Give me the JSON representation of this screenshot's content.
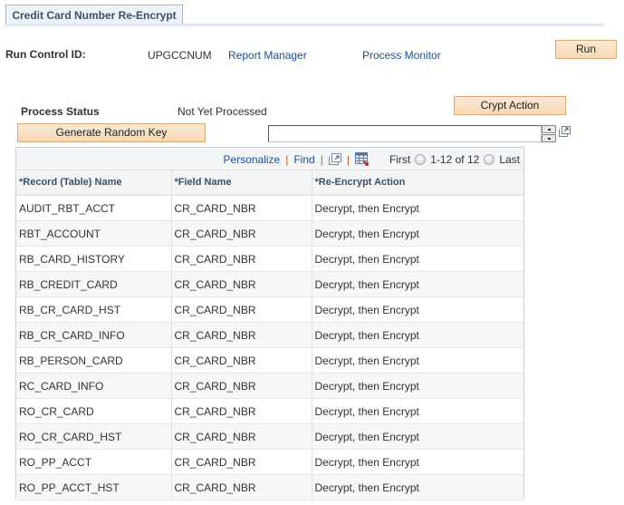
{
  "page": {
    "tab_title": "Credit Card Number Re-Encrypt"
  },
  "run_control": {
    "label": "Run Control ID:",
    "value": "UPGCCNUM",
    "report_manager_link": "Report Manager",
    "process_monitor_link": "Process Monitor",
    "run_button": "Run"
  },
  "process": {
    "status_label": "Process Status",
    "status_value": "Not Yet Processed",
    "crypt_action_button": "Crypt Action",
    "generate_key_button": "Generate Random Key",
    "key_input_value": ""
  },
  "grid": {
    "toolbar": {
      "personalize": "Personalize",
      "find": "Find",
      "first": "First",
      "range": "1-12 of 12",
      "last": "Last",
      "separator": "|"
    },
    "columns": [
      "*Record (Table) Name",
      "*Field Name",
      "*Re-Encrypt Action"
    ],
    "rows": [
      [
        "AUDIT_RBT_ACCT",
        "CR_CARD_NBR",
        "Decrypt, then Encrypt"
      ],
      [
        "RBT_ACCOUNT",
        "CR_CARD_NBR",
        "Decrypt, then Encrypt"
      ],
      [
        "RB_CARD_HISTORY",
        "CR_CARD_NBR",
        "Decrypt, then Encrypt"
      ],
      [
        "RB_CREDIT_CARD",
        "CR_CARD_NBR",
        "Decrypt, then Encrypt"
      ],
      [
        "RB_CR_CARD_HST",
        "CR_CARD_NBR",
        "Decrypt, then Encrypt"
      ],
      [
        "RB_CR_CARD_INFO",
        "CR_CARD_NBR",
        "Decrypt, then Encrypt"
      ],
      [
        "RB_PERSON_CARD",
        "CR_CARD_NBR",
        "Decrypt, then Encrypt"
      ],
      [
        "RC_CARD_INFO",
        "CR_CARD_NBR",
        "Decrypt, then Encrypt"
      ],
      [
        "RO_CR_CARD",
        "CR_CARD_NBR",
        "Decrypt, then Encrypt"
      ],
      [
        "RO_CR_CARD_HST",
        "CR_CARD_NBR",
        "Decrypt, then Encrypt"
      ],
      [
        "RO_PP_ACCT",
        "CR_CARD_NBR",
        "Decrypt, then Encrypt"
      ],
      [
        "RO_PP_ACCT_HST",
        "CR_CARD_NBR",
        "Decrypt, then Encrypt"
      ]
    ]
  },
  "colors": {
    "link": "#1b4f9a",
    "button_bg": "#f7d8b1",
    "button_border": "#d9a874",
    "header_text": "#3b4e6b",
    "separator": "#d1531f"
  }
}
